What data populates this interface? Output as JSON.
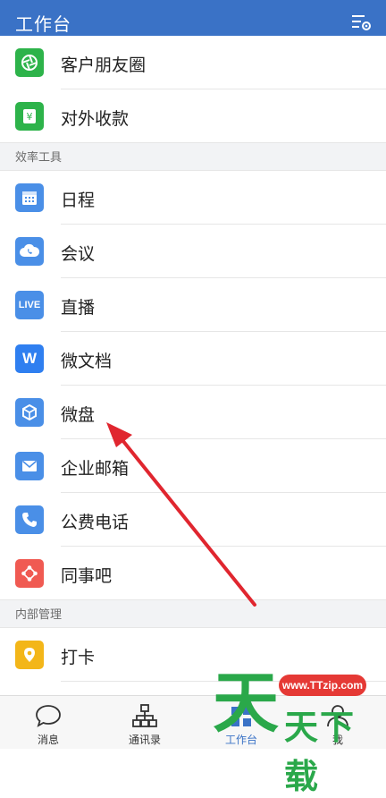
{
  "header": {
    "title": "工作台"
  },
  "top_items": [
    {
      "label": "客户朋友圈",
      "icon": "aperture-icon",
      "color": "#2db34a"
    },
    {
      "label": "对外收款",
      "icon": "yuan-wallet-icon",
      "color": "#2db34a"
    }
  ],
  "section_efficiency": "效率工具",
  "efficiency_items": [
    {
      "label": "日程",
      "icon": "calendar-icon",
      "color": "#4a8fe7"
    },
    {
      "label": "会议",
      "icon": "cloud-phone-icon",
      "color": "#4a8fe7"
    },
    {
      "label": "直播",
      "icon": "live-icon",
      "icon_text": "LIVE",
      "color": "#4a8fe7"
    },
    {
      "label": "微文档",
      "icon": "doc-w-icon",
      "icon_text": "W",
      "color": "#2f7ff0"
    },
    {
      "label": "微盘",
      "icon": "cube-icon",
      "color": "#4a8fe7"
    },
    {
      "label": "企业邮箱",
      "icon": "mail-icon",
      "color": "#4a8fe7"
    },
    {
      "label": "公费电话",
      "icon": "phone-icon",
      "color": "#4a8fe7"
    },
    {
      "label": "同事吧",
      "icon": "share-nodes-icon",
      "color": "#f05a52"
    }
  ],
  "section_internal": "内部管理",
  "internal_items": [
    {
      "label": "打卡",
      "icon": "location-pin-icon",
      "color": "#f3b619"
    }
  ],
  "tabbar": {
    "tabs": [
      {
        "label": "消息",
        "icon": "chat-bubble-icon"
      },
      {
        "label": "通讯录",
        "icon": "org-chart-icon"
      },
      {
        "label": "工作台",
        "icon": "workbench-icon",
        "active": true
      },
      {
        "label": "我",
        "icon": "person-icon"
      }
    ]
  },
  "watermark": {
    "url": "www.TTzip.com",
    "big_char": "天",
    "text": "天下载"
  },
  "colors": {
    "header": "#3a72c6",
    "accent": "#3a72c6",
    "arrow": "#e0262f"
  }
}
